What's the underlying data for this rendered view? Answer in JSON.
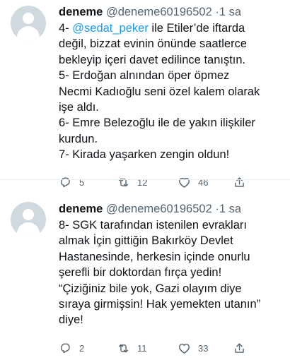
{
  "tweets": [
    {
      "name": "deneme",
      "handle": "@deneme60196502",
      "separator": "·",
      "time": "1 sa",
      "lines": [
        "4- ",
        "değil, bizzat evinin önünde saatlerce",
        "bekleyip içeri davet edilince tanıştın.",
        "5- Erdoğan alnından öper öpmez",
        "Necmi Kadıoğlu seni özel kalem olarak",
        "işe aldı.",
        "6- Emre Belezoğlu ile de yakın ilişkiler",
        "kurdun.",
        "7- Kirada yaşarken zengin oldun!"
      ],
      "mention": "@sedat_peker",
      "mention_after": " ile Etiler’de iftarda",
      "replies": "5",
      "retweets": "12",
      "likes": "46"
    },
    {
      "name": "deneme",
      "handle": "@deneme60196502",
      "separator": "·",
      "time": "1 sa",
      "lines": [
        "8- SGK tarafından istenilen evrakları",
        "almak İçin gittiğin Bakırköy Devlet",
        "Hastanesinde, herkesin içinde onurlu",
        "şerefli bir doktordan fırça yedin!",
        "“Çiziğiniz bile yok, Gazi olayım diye",
        "sıraya girmişsin! Hak yemekten utanın”",
        "diye!"
      ],
      "replies": "2",
      "retweets": "11",
      "likes": "33"
    }
  ]
}
